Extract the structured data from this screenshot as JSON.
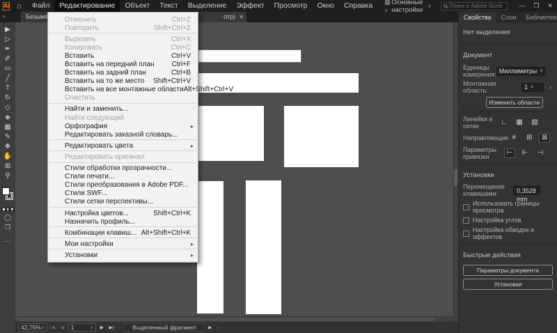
{
  "app": {
    "logo_text": "Ai",
    "menubar": {
      "items": [
        {
          "label": "Файл",
          "active": false
        },
        {
          "label": "Редактирование",
          "active": true
        },
        {
          "label": "Объект",
          "active": false
        },
        {
          "label": "Текст",
          "active": false
        },
        {
          "label": "Выделение",
          "active": false
        },
        {
          "label": "Эффект",
          "active": false
        },
        {
          "label": "Просмотр",
          "active": false
        },
        {
          "label": "Окно",
          "active": false
        },
        {
          "label": "Справка",
          "active": false
        }
      ]
    },
    "workspace_label": "Основные настройки",
    "search_placeholder": "Поиск в Adobe Stock",
    "window_controls": {
      "minimize": "—",
      "restore": "❐",
      "close": "✕"
    }
  },
  "tabbar": {
    "tools_collapse_icon": "»",
    "tab_left_text": "Безымянный",
    "tab_right_text": "отр)",
    "close_icon": "✕"
  },
  "edit_menu": {
    "items": [
      {
        "label": "Отменить",
        "shortcut": "Ctrl+Z",
        "disabled": true
      },
      {
        "label": "Повторить",
        "shortcut": "Shift+Ctrl+Z",
        "disabled": true,
        "sep": true
      },
      {
        "label": "Вырезать",
        "shortcut": "Ctrl+X",
        "disabled": true
      },
      {
        "label": "Копировать",
        "shortcut": "Ctrl+C",
        "disabled": true
      },
      {
        "label": "Вставить",
        "shortcut": "Ctrl+V"
      },
      {
        "label": "Вставить на передний план",
        "shortcut": "Ctrl+F"
      },
      {
        "label": "Вставить на задний план",
        "shortcut": "Ctrl+B"
      },
      {
        "label": "Вставить на то же место",
        "shortcut": "Shift+Ctrl+V"
      },
      {
        "label": "Вставить на все монтажные области",
        "shortcut": "Alt+Shift+Ctrl+V"
      },
      {
        "label": "Очистить",
        "disabled": true,
        "sep": true
      },
      {
        "label": "Найти и заменить..."
      },
      {
        "label": "Найти следующий",
        "disabled": true
      },
      {
        "label": "Орфография",
        "submenu": true
      },
      {
        "label": "Редактировать заказной словарь...",
        "sep": true
      },
      {
        "label": "Редактировать цвета",
        "submenu": true,
        "sep": true
      },
      {
        "label": "Редактировать оригинал",
        "disabled": true,
        "sep": true
      },
      {
        "label": "Стили обработки прозрачности..."
      },
      {
        "label": "Стили печати..."
      },
      {
        "label": "Стили преобразования в Adobe PDF..."
      },
      {
        "label": "Стили SWF..."
      },
      {
        "label": "Стили сетки перспективы...",
        "sep": true
      },
      {
        "label": "Настройка цветов...",
        "shortcut": "Shift+Ctrl+K"
      },
      {
        "label": "Назначить профиль...",
        "sep": true
      },
      {
        "label": "Комбинации клавиш...",
        "shortcut": "Alt+Shift+Ctrl+K",
        "sep": true
      },
      {
        "label": "Мои настройки",
        "submenu": true,
        "sep": true
      },
      {
        "label": "Установки",
        "submenu": true
      }
    ]
  },
  "toolbar": {
    "tools": [
      {
        "name": "selection-tool",
        "glyph": "▶"
      },
      {
        "name": "direct-selection-tool",
        "glyph": "▷"
      },
      {
        "name": "pen-tool",
        "glyph": "✒"
      },
      {
        "name": "curvature-tool",
        "glyph": "✐"
      },
      {
        "name": "rectangle-tool",
        "glyph": "▭"
      },
      {
        "name": "line-segment-tool",
        "glyph": "╱"
      },
      {
        "name": "type-tool",
        "glyph": "T"
      },
      {
        "name": "rotate-tool",
        "glyph": "↻"
      },
      {
        "name": "shape-builder-tool",
        "glyph": "◇"
      },
      {
        "name": "width-tool",
        "glyph": "◈"
      },
      {
        "name": "gradient-tool",
        "glyph": "▦"
      },
      {
        "name": "pencil-tool",
        "glyph": "✎"
      },
      {
        "name": "blend-tool",
        "glyph": "❖"
      },
      {
        "name": "hand-tool",
        "glyph": "✋"
      },
      {
        "name": "artboard-tool",
        "glyph": "⊞"
      },
      {
        "name": "zoom-tool",
        "glyph": "⚲"
      }
    ],
    "more_icon": "…"
  },
  "right_panel": {
    "tabs": [
      {
        "label": "Свойства",
        "active": true
      },
      {
        "label": "Слои",
        "active": false
      },
      {
        "label": "Библиотеки",
        "active": false
      }
    ],
    "collapse_icon": "»",
    "no_selection": "Нет выделения",
    "document_header": "Документ",
    "units_label": "Единицы измерения:",
    "units_value": "Миллиметры",
    "artboard_label": "Монтажная область:",
    "artboard_value": "1",
    "edit_artboards_button": "Изменить области",
    "rulers_label": "Линейки и сетки",
    "guides_label": "Направляющие",
    "snap_label": "Параметры привязки",
    "prefs_header": "Установки",
    "keyboard_label": "Перемещение клавишами:",
    "keyboard_value": "0,3528 mm",
    "checkboxes": [
      "Использовать границы просмотра",
      "Настройка углов",
      "Настройка обводок и эффектов"
    ],
    "quick_actions_header": "Быстрые действия",
    "doc_setup_button": "Параметры документа",
    "preferences_button": "Установки"
  },
  "statusbar": {
    "zoom_value": "42,75%",
    "artboard_number": "1",
    "status_text": "Выделенный фрагмент"
  }
}
